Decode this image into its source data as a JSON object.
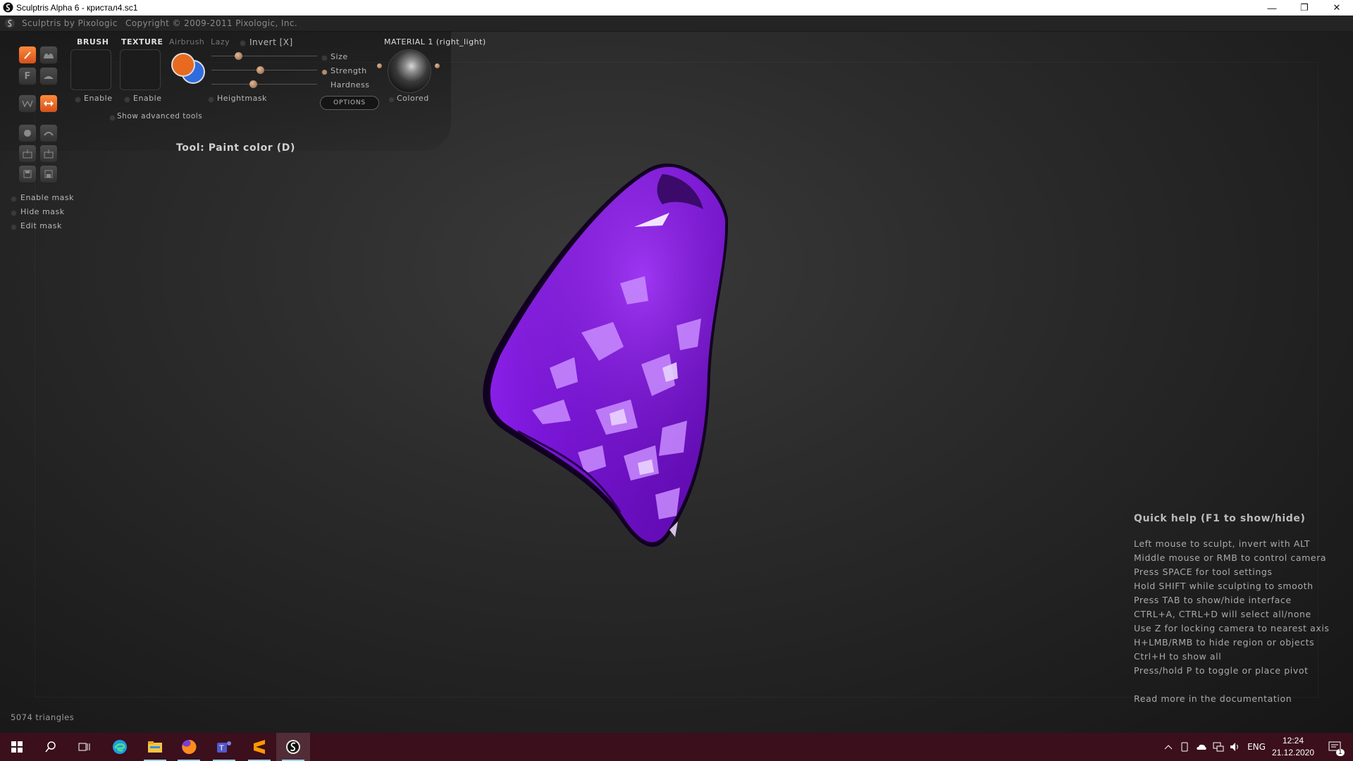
{
  "window": {
    "title": "Sculptris Alpha 6 - кристал4.sc1",
    "controls": {
      "minimize": "—",
      "restore": "❐",
      "close": "✕"
    }
  },
  "app_header": {
    "brand": "Sculptris by Pixologic",
    "copyright": "Copyright © 2009-2011 Pixologic, Inc."
  },
  "tool_panel": {
    "tabs": {
      "brush": "BRUSH",
      "texture": "TEXTURE",
      "airbrush": "Airbrush",
      "lazy": "Lazy",
      "invert": "Invert [X]"
    },
    "brush_enable": "Enable",
    "texture_enable": "Enable",
    "heightmask": "Heightmask",
    "show_advanced": "Show advanced tools",
    "sliders": [
      {
        "label": "Size",
        "value": 0.25
      },
      {
        "label": "Strength",
        "value": 0.46
      },
      {
        "label": "Hardness",
        "value": 0.39
      }
    ],
    "options_button": "OPTIONS",
    "material_label": "MATERIAL 1 (right_light)",
    "colored": "Colored",
    "primary_color": "#e86a1e",
    "secondary_color": "#2f6ce0"
  },
  "toolbar_buttons": [
    "crease",
    "flatten-f",
    "wax",
    "paint-bump",
    "draw-tool",
    "inflate",
    "symmetry-tool",
    "grab-tool",
    "sphere-tool",
    "scale-tool",
    "obj-import",
    "obj-export",
    "save-tool",
    "load-tool"
  ],
  "mask_options": [
    "Enable mask",
    "Hide mask",
    "Edit mask"
  ],
  "current_tool": "Tool: Paint color (D)",
  "model": {
    "color": "#8a1ee8"
  },
  "quick_help": {
    "title": "Quick help (F1 to show/hide)",
    "lines": [
      "Left mouse to sculpt, invert with ALT",
      "Middle mouse or RMB to control camera",
      "Press SPACE for tool settings",
      "Hold SHIFT while sculpting to smooth",
      "Press TAB to show/hide interface",
      "CTRL+A, CTRL+D will select all/none",
      "Use Z for locking camera to nearest axis",
      "H+LMB/RMB to hide region or objects",
      "Ctrl+H to show all",
      "Press/hold P to toggle or place pivot"
    ],
    "footer": "Read more in the documentation"
  },
  "status": {
    "triangles": "5074 triangles"
  },
  "taskbar": {
    "apps": [
      "start-icon",
      "search-icon",
      "task-view-icon",
      "edge-icon",
      "file-explorer-icon",
      "firefox-icon",
      "teams-icon",
      "sublime-icon",
      "sculptris-icon"
    ],
    "tray": {
      "language": "ENG",
      "time": "12:24",
      "date": "21.12.2020",
      "notifications": "1"
    }
  }
}
